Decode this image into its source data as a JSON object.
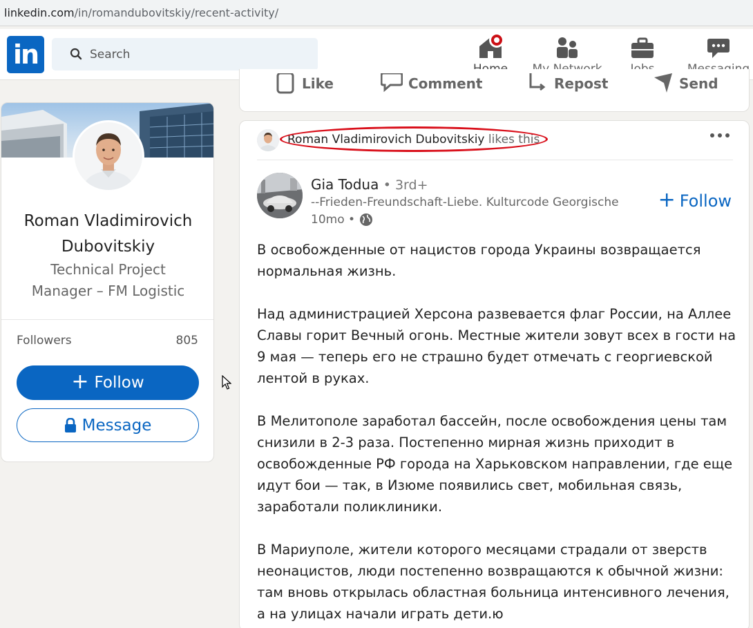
{
  "browser": {
    "url_host": "linkedin.com",
    "url_path": "/in/romandubovitskiy/recent-activity/"
  },
  "nav": {
    "logo": "in",
    "search_placeholder": "Search",
    "items": [
      {
        "label": "Home",
        "icon": "home-icon"
      },
      {
        "label": "My Network",
        "icon": "network-icon"
      },
      {
        "label": "Jobs",
        "icon": "briefcase-icon"
      },
      {
        "label": "Messaging",
        "icon": "messaging-icon"
      }
    ]
  },
  "profile": {
    "name": "Roman Vladimirovich Dubovitskiy",
    "name_line1": "Roman Vladimirovich",
    "name_line2": "Dubovitskiy",
    "title_line1": "Technical Project",
    "title_line2": "Manager – FM Logistic",
    "followers_label": "Followers",
    "followers_count": "805",
    "follow_label": "Follow",
    "message_label": "Message"
  },
  "prev_post_actions": {
    "like": "Like",
    "comment": "Comment",
    "repost": "Repost",
    "send": "Send"
  },
  "feed_post": {
    "liker_name": "Roman Vladimirovich Dubovitskiy",
    "liker_verb": "likes this",
    "author_name": "Gia Todua",
    "author_degree": "• 3rd+",
    "author_headline": "--Frieden-Freundschaft-Liebe. Kulturcode Georgische",
    "time": "10mo •",
    "follow_label": "Follow",
    "paragraphs": [
      "В освобожденные от нацистов города Украины возвращается нормальная жизнь.",
      "Над администрацией Херсона развевается флаг России, на Аллее Славы горит Вечный огонь. Местные жители зовут всех в гости на 9 мая — теперь его не страшно будет отмечать с георгиевской лентой в руках.",
      "В Мелитополе заработал бассейн, после освобождения цены там снизили в 2-3 раза. Постепенно мирная жизнь приходит в освобожденные РФ города на Харьковском направлении, где еще идут бои — так, в Изюме появились свет, мобильная связь, заработали поликлиники.",
      "В Мариуполе, жители которого месяцами страдали от зверств неонацистов, люди постепенно возвращаются к обычной жизни: там вновь открылась областная больница интенсивного лечения, а на улицах начали играть дети.ю"
    ]
  },
  "colors": {
    "brand": "#0a66c2",
    "annotation_red": "#d9101b",
    "notification": "#cc1016"
  }
}
